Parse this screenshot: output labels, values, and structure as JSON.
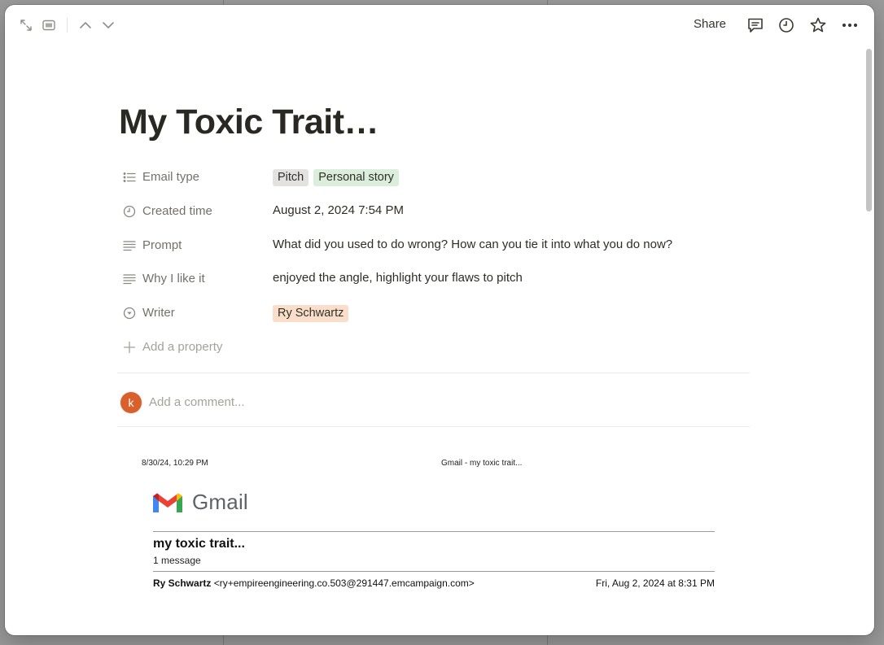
{
  "topbar": {
    "share_label": "Share",
    "icons": [
      "expand-icon",
      "side-peek-icon",
      "chevron-up-icon",
      "chevron-down-icon",
      "comment-icon",
      "clock-icon",
      "star-icon",
      "more-icon"
    ]
  },
  "page": {
    "title": "My Toxic Trait…"
  },
  "properties": {
    "email_type": {
      "label": "Email type",
      "tags": [
        {
          "text": "Pitch",
          "color": "#e3e2e0"
        },
        {
          "text": "Personal story",
          "color": "#dbeddb"
        }
      ]
    },
    "created_time": {
      "label": "Created time",
      "value": "August 2, 2024 7:54 PM"
    },
    "prompt": {
      "label": "Prompt",
      "value": "What did you used to do wrong? How can you tie it into what you do now?"
    },
    "why_i_like_it": {
      "label": "Why I like it",
      "value": "enjoyed the angle, highlight your flaws to pitch"
    },
    "writer": {
      "label": "Writer",
      "tag": {
        "text": "Ry Schwartz",
        "color": "#fadec9"
      }
    },
    "add_property_label": "Add a property"
  },
  "comment": {
    "avatar_letter": "k",
    "avatar_color": "#d9602a",
    "placeholder": "Add a comment..."
  },
  "email_pdf": {
    "print_date": "8/30/24, 10:29 PM",
    "print_header": "Gmail - my toxic trait...",
    "logo_word": "Gmail",
    "subject": "my toxic trait...",
    "message_count": "1 message",
    "from_name": "Ry Schwartz",
    "from_address": "<ry+empireengineering.co.503@291447.emcampaign.com>",
    "sent_date": "Fri, Aug 2, 2024 at 8:31 PM"
  }
}
